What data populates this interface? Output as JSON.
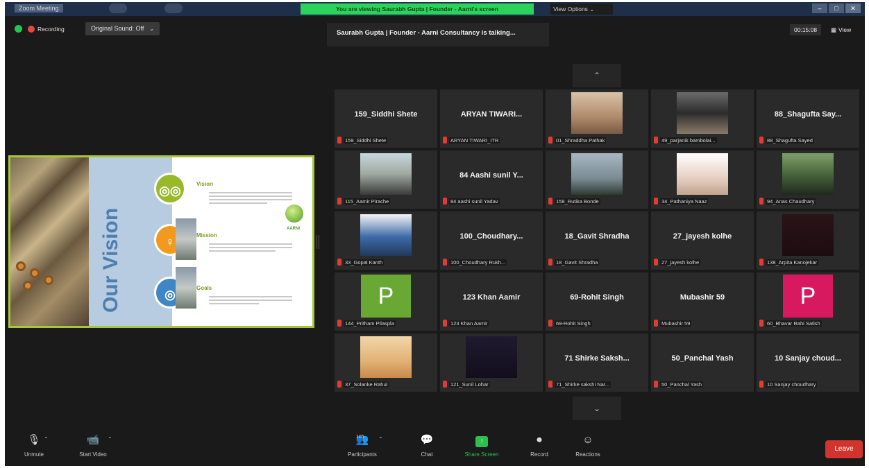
{
  "window": {
    "title": "Zoom Meeting",
    "viewing_banner": "You are viewing Saurabh Gupta | Founder - Aarni's screen",
    "view_options": "View Options ⌄"
  },
  "meeting": {
    "recording_label": "Recording",
    "sound_button": "Original Sound: Off",
    "speaker_banner": "Saurabh Gupta | Founder - Aarni Consultancy is talking...",
    "time": "00:15:08",
    "view_button": "View"
  },
  "slide": {
    "title": "Our Vision",
    "sections": [
      {
        "heading": "Vision",
        "icon": "binoculars-icon",
        "glyph": "◎◎",
        "color": "#9ab92a"
      },
      {
        "heading": "Mission",
        "icon": "lightbulb-icon",
        "glyph": "♀",
        "color": "#f39a1e"
      },
      {
        "heading": "Goals",
        "icon": "target-icon",
        "glyph": "◎",
        "color": "#3f86c6"
      }
    ],
    "logo_label": "AARNI"
  },
  "participants": [
    {
      "big_name": "159_Siddhi Shete",
      "name": "159_Siddhi Shete",
      "kind": "name"
    },
    {
      "big_name": "ARYAN TIWARI...",
      "name": "ARYAN TIWARI_ITR",
      "kind": "name"
    },
    {
      "big_name": "",
      "name": "01_Shraddha Pathak",
      "kind": "photo"
    },
    {
      "big_name": "",
      "name": "49_parjanik bambolai...",
      "kind": "photo"
    },
    {
      "big_name": "88_Shagufta Say...",
      "name": "88_Shagufta Sayed",
      "kind": "name"
    },
    {
      "big_name": "",
      "name": "115_Aamir Pirache",
      "kind": "photo"
    },
    {
      "big_name": "84 Aashi sunil Y...",
      "name": "84 aashi sunil Yadav",
      "kind": "name"
    },
    {
      "big_name": "",
      "name": "158_Rutika Bonde",
      "kind": "photo"
    },
    {
      "big_name": "",
      "name": "34_Pathaniya Naaz",
      "kind": "photo"
    },
    {
      "big_name": "",
      "name": "94_Anas Chaudhary",
      "kind": "photo"
    },
    {
      "big_name": "",
      "name": "33_Gopal Kanth",
      "kind": "photo"
    },
    {
      "big_name": "100_Choudhary...",
      "name": "100_Choudhary Rukh...",
      "kind": "name"
    },
    {
      "big_name": "18_Gavit Shradha",
      "name": "18_Gavit Shradha",
      "kind": "name"
    },
    {
      "big_name": "27_jayesh kolhe",
      "name": "27_jayesh kolhe",
      "kind": "name"
    },
    {
      "big_name": "",
      "name": "138_Arpita Kanojekar",
      "kind": "photo"
    },
    {
      "big_name": "",
      "name": "144_Pritham Pilaspla",
      "kind": "avatar",
      "letter": "P",
      "color": "#6aa834"
    },
    {
      "big_name": "123 Khan Aamir",
      "name": "123 Khan Aamir",
      "kind": "name"
    },
    {
      "big_name": "69-Rohit Singh",
      "name": "69-Rohit Singh",
      "kind": "name"
    },
    {
      "big_name": "Mubashir 59",
      "name": "Mubashir 59",
      "kind": "name"
    },
    {
      "big_name": "",
      "name": "60_Bhavar Rahi Satish",
      "kind": "avatar",
      "letter": "P",
      "color": "#d8195f"
    },
    {
      "big_name": "",
      "name": "37_Solanke Rahul",
      "kind": "photo"
    },
    {
      "big_name": "",
      "name": "121_Sunil Lohar",
      "kind": "photo"
    },
    {
      "big_name": "71 Shirke Saksh...",
      "name": "71_Shirke sakshi Nar...",
      "kind": "name"
    },
    {
      "big_name": "50_Panchal Yash",
      "name": "50_Panchal Yash",
      "kind": "name"
    },
    {
      "big_name": "10 Sanjay choud...",
      "name": "10 Sanjay choudhary",
      "kind": "name"
    }
  ],
  "toolbar": {
    "unmute": "Unmute",
    "start_video": "Start Video",
    "participants": "Participants",
    "participants_count": "105",
    "chat": "Chat",
    "share_screen": "Share Screen",
    "record": "Record",
    "reactions": "Reactions",
    "leave": "Leave"
  }
}
